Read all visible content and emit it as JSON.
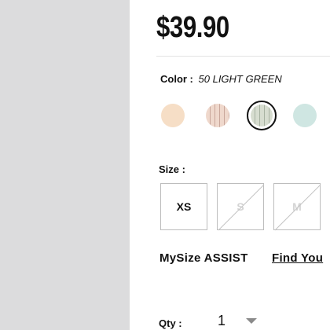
{
  "product": {
    "price": "$39.90"
  },
  "color": {
    "label": "Color :",
    "selected_value": "50 LIGHT GREEN",
    "swatches": [
      {
        "name": "peach",
        "color": "#f6dec6",
        "pattern": "solid"
      },
      {
        "name": "pink-stripe",
        "color": "#efd8cc",
        "stripe": "#c9a79b",
        "pattern": "stripe"
      },
      {
        "name": "light-green",
        "color": "#d7ddd0",
        "stripe": "#a8b2a2",
        "pattern": "stripe",
        "selected": true
      },
      {
        "name": "mint",
        "color": "#cfe6e2",
        "pattern": "solid"
      }
    ]
  },
  "size": {
    "label": "Size :",
    "options": [
      {
        "label": "XS",
        "available": true
      },
      {
        "label": "S",
        "available": false
      },
      {
        "label": "M",
        "available": false
      }
    ]
  },
  "mysize": {
    "label": "MySize ASSIST",
    "link": "Find You"
  },
  "quantity": {
    "label": "Qty :",
    "value": "1"
  }
}
